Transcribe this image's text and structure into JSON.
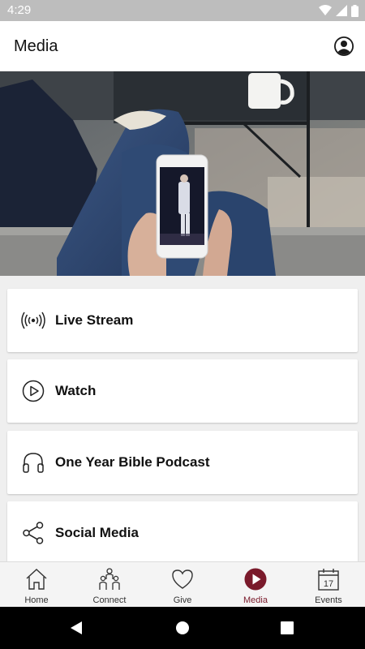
{
  "status_bar": {
    "time": "4:29"
  },
  "app_bar": {
    "title": "Media"
  },
  "menu": [
    {
      "label": "Live Stream",
      "icon": "live-stream-icon"
    },
    {
      "label": "Watch",
      "icon": "play-circle-icon"
    },
    {
      "label": "One Year Bible Podcast",
      "icon": "headphones-icon"
    },
    {
      "label": "Social Media",
      "icon": "share-icon"
    }
  ],
  "bottom_nav": [
    {
      "label": "Home",
      "icon": "home-icon"
    },
    {
      "label": "Connect",
      "icon": "people-icon"
    },
    {
      "label": "Give",
      "icon": "heart-icon"
    },
    {
      "label": "Media",
      "icon": "play-icon",
      "active": true
    },
    {
      "label": "Events",
      "icon": "calendar-icon",
      "calendar_day": "17"
    }
  ],
  "colors": {
    "accent": "#7a1a2b",
    "status_bar": "#bdbdbd",
    "background": "#efefef"
  }
}
